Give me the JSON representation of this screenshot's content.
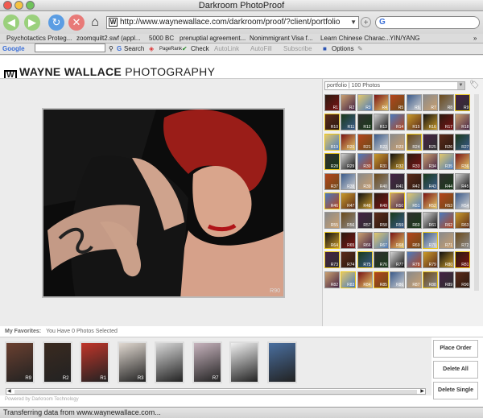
{
  "window": {
    "title": "Darkroom PhotoProof"
  },
  "toolbar": {
    "url": "http://www.waynewallace.com/darkroom/proof/?client/portfolio",
    "url_favicon": "W",
    "search_icon": "G"
  },
  "bookmarks": [
    "Psychotactics Proteg...",
    "zoomquilt2.swf (appl...",
    "5000 BC",
    "prenuptial agreement...",
    "Nonimmigrant Visa f...",
    "Learn Chinese Charac...",
    "YIN/YANG"
  ],
  "google_bar": {
    "logo": "Google",
    "search": "Search",
    "pagerank": "PageRank",
    "check": "Check",
    "autolink": "AutoLink",
    "autofill": "AutoFill",
    "subscribe": "Subscribe",
    "options": "Options"
  },
  "site": {
    "logo_mark": "W",
    "brand_bold": "WAYNE WALLACE",
    "brand_light": "PHOTOGRAPHY"
  },
  "viewer": {
    "photo_code": "R90"
  },
  "sidebar": {
    "select_value": "portfolio | 100 Photos",
    "thumbs": [
      "R1",
      "R2",
      "R3",
      "R4",
      "R5",
      "R6",
      "R7",
      "R8",
      "R9",
      "R10",
      "R11",
      "R12",
      "R13",
      "R14",
      "R15",
      "R16",
      "R17",
      "R18",
      "R19",
      "R20",
      "R21",
      "R22",
      "R23",
      "R24",
      "R25",
      "R26",
      "R27",
      "R28",
      "R29",
      "R30",
      "R31",
      "R32",
      "R33",
      "R34",
      "R35",
      "R36",
      "R37",
      "R38",
      "R39",
      "R40",
      "R41",
      "R42",
      "R43",
      "R44",
      "R45",
      "R46",
      "R47",
      "R48",
      "R49",
      "R50",
      "R51",
      "R52",
      "R53",
      "R54",
      "R55",
      "R56",
      "R57",
      "R58",
      "R59",
      "R60",
      "R61",
      "R62",
      "R63",
      "R64",
      "R65",
      "R66",
      "R67",
      "R68",
      "R69",
      "R70",
      "R71",
      "R72",
      "R73",
      "R74",
      "R75",
      "R76",
      "R77",
      "R78",
      "R79",
      "R80",
      "R81",
      "R82",
      "R83",
      "R84",
      "R85",
      "R86",
      "R87",
      "R88",
      "R89",
      "R90"
    ]
  },
  "favorites": {
    "label": "My Favorites:",
    "summary": "You Have 0 Photos Selected",
    "thumbs": [
      "R9",
      "R2",
      "R1",
      "R3",
      "",
      "R7",
      "",
      ""
    ]
  },
  "actions": {
    "place_order": "Place Order",
    "delete_all": "Delete All",
    "delete_single": "Delete Single"
  },
  "footer": {
    "powered": "Powered by Darkroom Technology"
  },
  "status": {
    "text": "Transferring data from www.waynewallace.com..."
  }
}
